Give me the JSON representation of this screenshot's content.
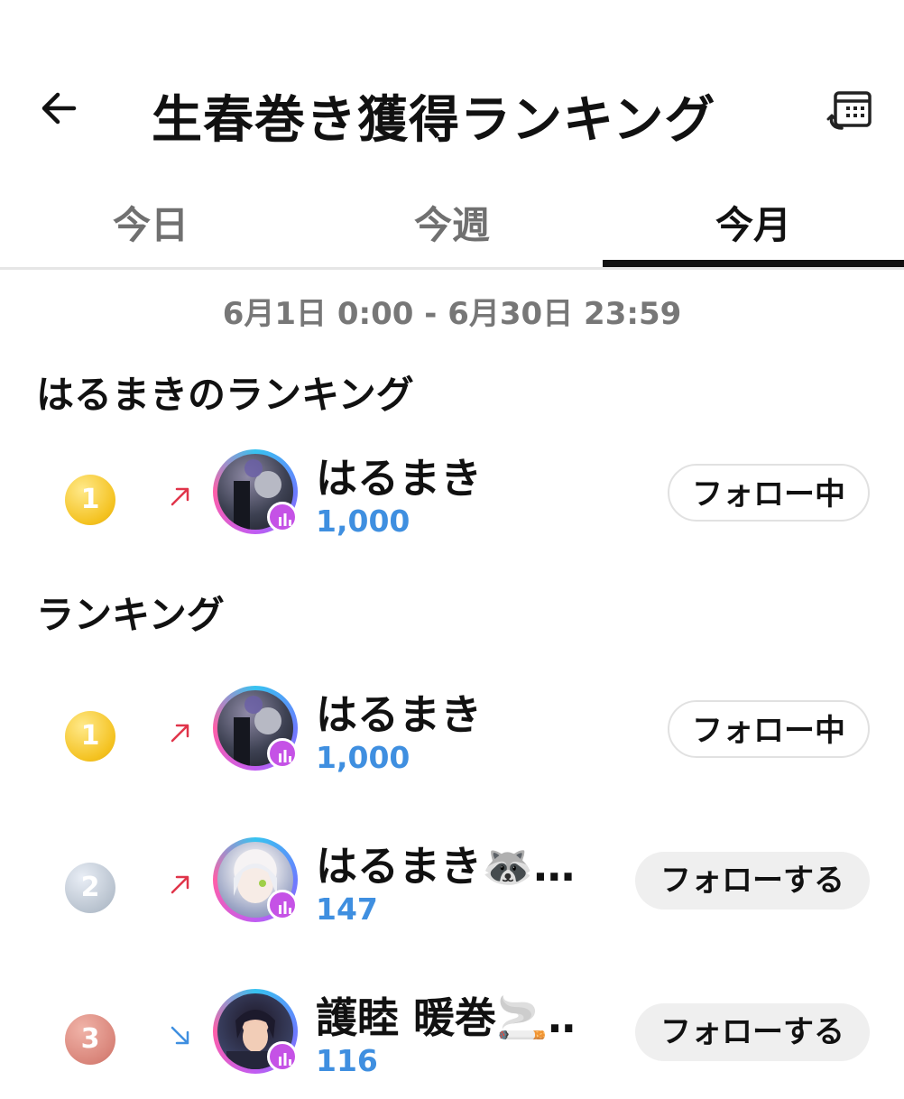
{
  "header": {
    "title": "生春巻き獲得ランキング",
    "back_icon": "arrow-left-icon",
    "calendar_icon": "calendar-history-icon"
  },
  "tabs": [
    {
      "label": "今日",
      "active": false
    },
    {
      "label": "今週",
      "active": false
    },
    {
      "label": "今月",
      "active": true
    }
  ],
  "period": "6月1日 0:00 - 6月30日 23:59",
  "my_ranking": {
    "title": "はるまきのランキング",
    "entry": {
      "rank": "1",
      "trend": "up",
      "name": "はるまき",
      "score": "1,000",
      "follow_label": "フォロー中"
    }
  },
  "ranking": {
    "title": "ランキング",
    "entries": [
      {
        "rank": "1",
        "trend": "up",
        "name": "はるまき",
        "score": "1,000",
        "follow_label": "フォロー中"
      },
      {
        "rank": "2",
        "trend": "up",
        "name": "はるまき🦝…",
        "score": "147",
        "follow_label": "フォローする"
      },
      {
        "rank": "3",
        "trend": "down",
        "name": "護睦 暖巻🚬…",
        "score": "116",
        "follow_label": "フォローする"
      }
    ]
  },
  "colors": {
    "score": "#3f8fe0",
    "trend_up": "#e0344a",
    "trend_down": "#3f8fe0",
    "gold": "#f4c220",
    "silver": "#b9c3cf",
    "bronze": "#d9857a",
    "badge": "#c552e6"
  }
}
